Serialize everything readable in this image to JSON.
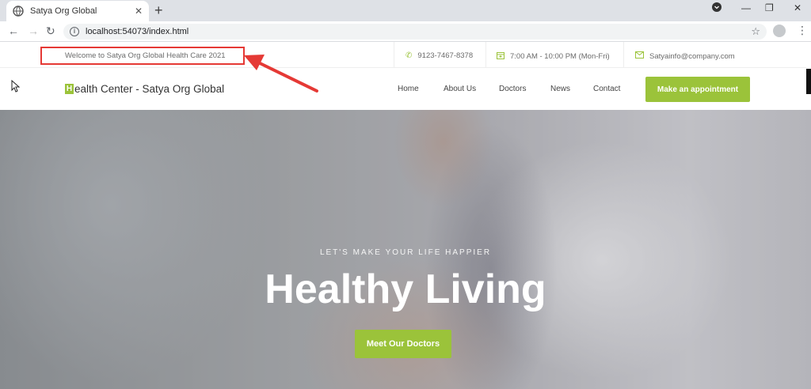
{
  "browser": {
    "tab_title": "Satya Org Global",
    "new_tab": "+",
    "url": "localhost:54073/index.html"
  },
  "topbar": {
    "welcome": "Welcome to Satya Org Global Health Care 2021",
    "phone": "9123-7467-8378",
    "hours": "7:00 AM - 10:00 PM (Mon-Fri)",
    "email": "Satyainfo@company.com"
  },
  "nav": {
    "logo_letter": "H",
    "logo_rest": "ealth Center - Satya Org Global",
    "links": [
      "Home",
      "About Us",
      "Doctors",
      "News",
      "Contact"
    ],
    "cta": "Make an appointment"
  },
  "hero": {
    "kicker": "LET'S MAKE YOUR LIFE HAPPIER",
    "title": "Healthy Living",
    "button": "Meet Our Doctors"
  },
  "colors": {
    "accent": "#9bc33a",
    "annotation": "#e53935"
  },
  "icons": {
    "phone": "phone-icon",
    "calendar": "calendar-icon",
    "email": "envelope-icon"
  }
}
